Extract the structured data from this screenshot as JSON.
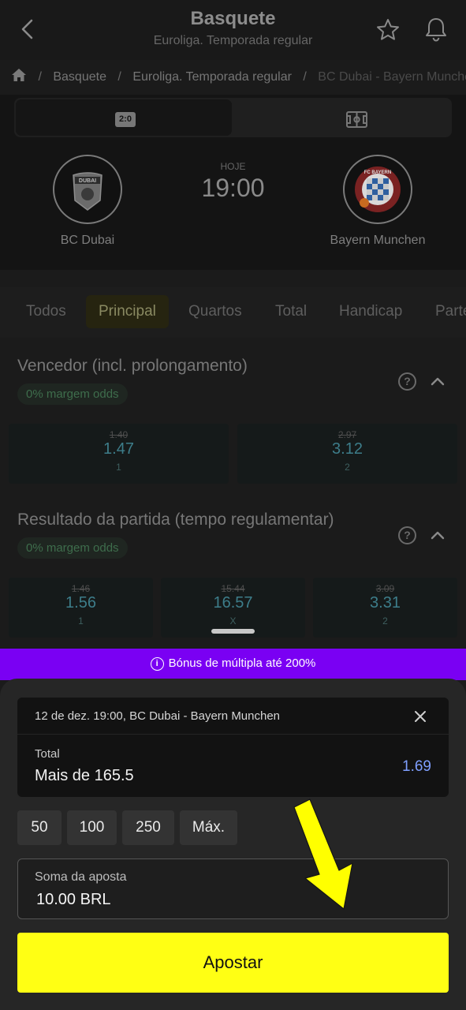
{
  "header": {
    "title": "Basquete",
    "subtitle": "Euroliga. Temporada regular"
  },
  "breadcrumb": [
    "Basquete",
    "Euroliga. Temporada regular",
    "BC Dubai - Bayern Munchen"
  ],
  "score_switch": {
    "score_label": "2:0"
  },
  "match": {
    "home": "BC Dubai",
    "away": "Bayern Munchen",
    "home_logo_text": "DUBAI",
    "away_logo_text": "FC BAYERN",
    "day": "HOJE",
    "time": "19:00"
  },
  "tabs": [
    "Todos",
    "Principal",
    "Quartos",
    "Total",
    "Handicap",
    "Parte"
  ],
  "markets": [
    {
      "title": "Vencedor (incl. prolongamento)",
      "badge": "0% margem odds",
      "help": "?",
      "odds": [
        {
          "old": "1.40",
          "value": "1.47",
          "label": "1"
        },
        {
          "old": "2.97",
          "value": "3.12",
          "label": "2"
        }
      ]
    },
    {
      "title": "Resultado da partida (tempo regulamentar)",
      "badge": "0% margem odds",
      "help": "?",
      "odds": [
        {
          "old": "1.46",
          "value": "1.56",
          "label": "1"
        },
        {
          "old": "15.44",
          "value": "16.57",
          "label": "X"
        },
        {
          "old": "3.09",
          "value": "3.31",
          "label": "2"
        }
      ]
    }
  ],
  "bonus_banner": {
    "icon": "i",
    "text": "Bónus de múltipla até 200%"
  },
  "bet_slip": {
    "event": "12 de dez. 19:00, BC Dubai - Bayern Munchen",
    "market": "Total",
    "selection": "Mais de 165.5",
    "odd": "1.69"
  },
  "quick_stakes": [
    "50",
    "100",
    "250",
    "Máx."
  ],
  "stake": {
    "label": "Soma da aposta",
    "value": "10.00 BRL"
  },
  "submit_label": "Apostar",
  "colors": {
    "accent": "#ffff14",
    "bonus": "#7a00f3",
    "odds": "#7f9fff",
    "arrow": "#ffff00"
  }
}
